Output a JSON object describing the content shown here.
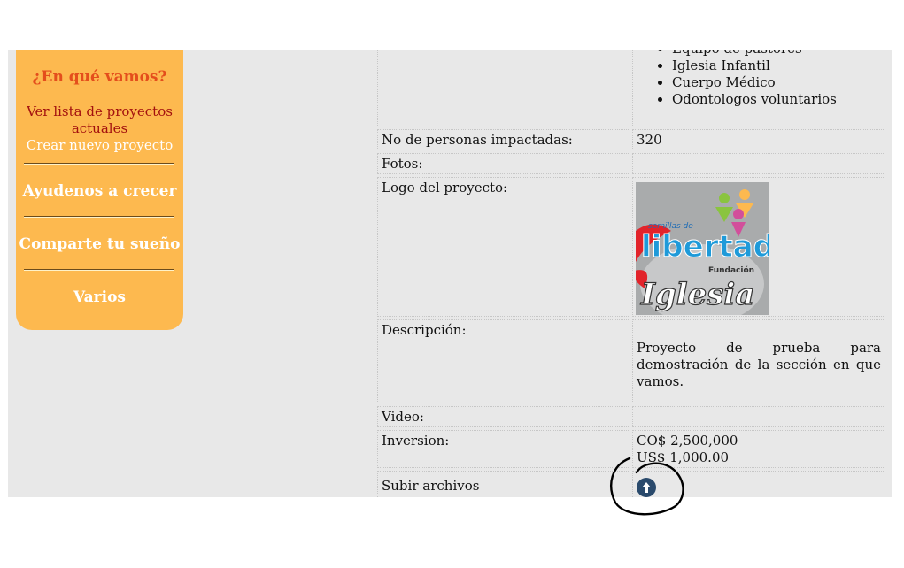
{
  "sidebar": {
    "question": "¿En qué vamos?",
    "list_link": "Ver lista de proyectos actuales",
    "new_link": "Crear nuevo proyecto",
    "grow": "Ayudenos a crecer",
    "share": "Comparte tu sueño",
    "misc": "Varios"
  },
  "team": [
    "Equipo de pastores",
    "Iglesia Infantil",
    "Cuerpo Médico",
    "Odontologos voluntarios"
  ],
  "rows": {
    "people_label": "No de personas impactadas:",
    "people_value": "320",
    "photos_label": "Fotos:",
    "logo_label": "Logo del proyecto:",
    "desc_label": "Descripción:",
    "desc_value": "Proyecto de prueba para demostración de la sección en que vamos.",
    "video_label": "Video:",
    "invest_label": "Inversion:",
    "invest_cop": "CO$ 2,500,000",
    "invest_usd": "US$ 1,000.00",
    "upload_label": "Subir archivos"
  },
  "logo": {
    "top_small": "semillas de",
    "word": "libertad",
    "fund": "Fundación",
    "church": "Iglesia"
  },
  "colors": {
    "sidebar": "#fdb94f",
    "accent": "#e44e1c",
    "link": "#a3110f",
    "upload": "#2a4a6c"
  }
}
